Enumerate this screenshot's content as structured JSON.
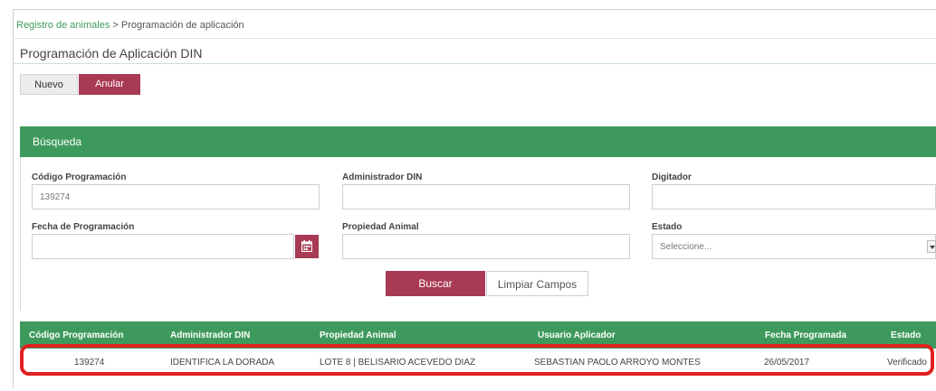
{
  "breadcrumb": {
    "link": "Registro de animales",
    "separator": " > ",
    "current": "Programación de aplicación"
  },
  "page_title": "Programación de Aplicación DIN",
  "toolbar": {
    "nuevo_label": "Nuevo",
    "anular_label": "Anular"
  },
  "search": {
    "header": "Búsqueda",
    "fields": {
      "codigo": {
        "label": "Código Programación",
        "value": "139274"
      },
      "administrador": {
        "label": "Administrador DIN",
        "value": ""
      },
      "digitador": {
        "label": "Digitador",
        "value": ""
      },
      "fecha": {
        "label": "Fecha de Programación",
        "value": ""
      },
      "propiedad": {
        "label": "Propiedad Animal",
        "value": ""
      },
      "estado": {
        "label": "Estado",
        "selected": "Seleccione..."
      }
    },
    "buscar_label": "Buscar",
    "limpiar_label": "Limpiar Campos"
  },
  "table": {
    "headers": [
      "Código Programación",
      "Administrador DIN",
      "Propiedad Animal",
      "Usuario Aplicador",
      "Fecha Programada",
      "Estado"
    ],
    "rows": [
      [
        "139274",
        "IDENTIFICA LA DORADA",
        "LOTE 8 | BELISARIO ACEVEDO DIAZ",
        "SEBASTIAN PAOLO ARROYO MONTES",
        "26/05/2017",
        "Verificado"
      ]
    ]
  },
  "colors": {
    "green": "#3e9a5c",
    "accent": "#a83a55",
    "highlight": "#e02020"
  },
  "icons": {
    "calendar": "calendar-icon",
    "select_arrow": "chevron-down-icon"
  }
}
